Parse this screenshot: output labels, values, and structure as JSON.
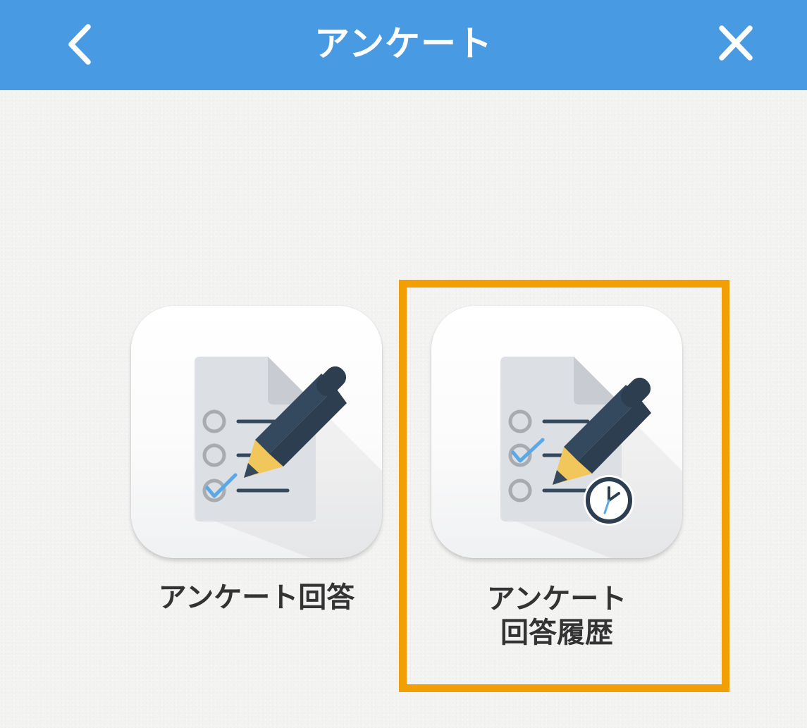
{
  "header": {
    "title": "アンケート",
    "back_icon": "chevron-left-icon",
    "close_icon": "close-icon",
    "background_color": "#489be2"
  },
  "menu": {
    "items": [
      {
        "icon": "survey-checklist-pencil-icon",
        "label_lines": [
          "アンケート回答"
        ]
      },
      {
        "icon": "survey-history-clock-icon",
        "label_lines": [
          "アンケート",
          "回答履歴"
        ],
        "highlighted": true
      }
    ]
  },
  "colors": {
    "highlight_border": "#f29e05",
    "check_mark": "#5aa9e6",
    "pencil_body": "#34495e",
    "pencil_tip": "#f1c75b"
  }
}
